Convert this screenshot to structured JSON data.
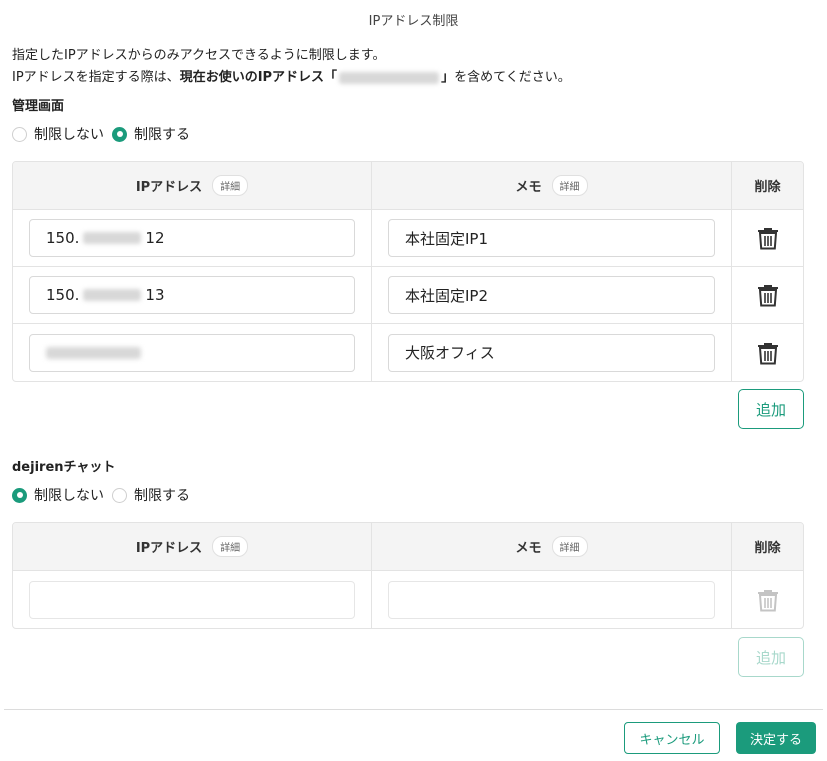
{
  "dialog": {
    "title": "IPアドレス制限",
    "desc_line1": "指定したIPアドレスからのみアクセスできるように制限します。",
    "desc_line2_prefix": "IPアドレスを指定する際は、",
    "desc_line2_bold": "現在お使いのIPアドレス「",
    "desc_line2_close": "」",
    "desc_line2_suffix": "を含めてください。"
  },
  "admin": {
    "title": "管理画面",
    "radio_off": "制限しない",
    "radio_on": "制限する",
    "selected": "制限する",
    "table": {
      "col_ip": "IPアドレス",
      "col_memo": "メモ",
      "col_delete": "削除",
      "detail_badge": "詳細",
      "rows": [
        {
          "ip_prefix": "150.",
          "ip_suffix": "12",
          "memo": "本社固定IP1"
        },
        {
          "ip_prefix": "150.",
          "ip_suffix": "13",
          "memo": "本社固定IP2"
        },
        {
          "ip_prefix": "",
          "ip_suffix": "",
          "memo": "大阪オフィス"
        }
      ]
    },
    "add_label": "追加"
  },
  "chat": {
    "title": "dejirenチャット",
    "radio_off": "制限しない",
    "radio_on": "制限する",
    "selected": "制限しない",
    "table": {
      "col_ip": "IPアドレス",
      "col_memo": "メモ",
      "col_delete": "削除",
      "detail_badge": "詳細",
      "rows": [
        {
          "ip": "",
          "memo": ""
        }
      ]
    },
    "add_label": "追加"
  },
  "footer": {
    "cancel_label": "キャンセル",
    "ok_label": "決定する"
  },
  "colors": {
    "accent": "#1b9b7c",
    "accent_disabled": "#a8d8cb"
  }
}
